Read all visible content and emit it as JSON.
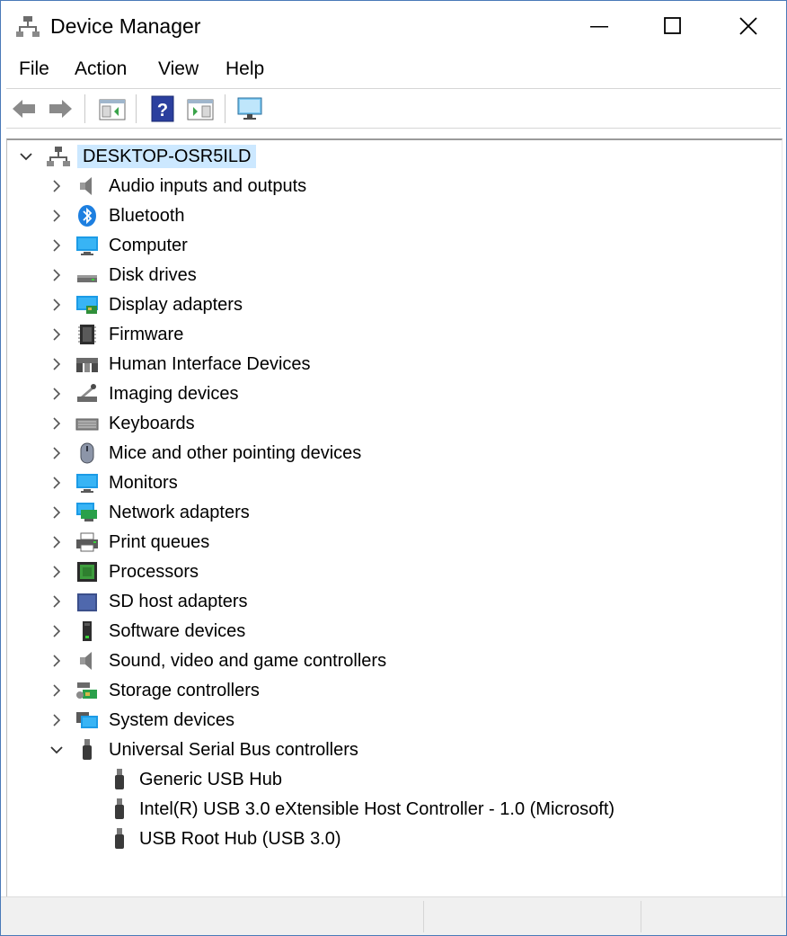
{
  "window": {
    "title": "Device Manager"
  },
  "menu": [
    {
      "label": "File"
    },
    {
      "label": "Action"
    },
    {
      "label": "View"
    },
    {
      "label": "Help"
    }
  ],
  "toolbar": {
    "buttons": [
      "back-icon",
      "forward-icon",
      "show-hide-console-tree-icon",
      "help-icon",
      "show-hide-action-pane-icon",
      "scan-hardware-changes-icon"
    ]
  },
  "tree": {
    "root": {
      "label": "DESKTOP-OSR5ILD",
      "icon": "computer-network-icon",
      "expanded": true,
      "selected": true
    },
    "categories": [
      {
        "label": "Audio inputs and outputs",
        "icon": "speaker-icon",
        "expanded": false
      },
      {
        "label": "Bluetooth",
        "icon": "bluetooth-icon",
        "expanded": false
      },
      {
        "label": "Computer",
        "icon": "monitor-icon",
        "expanded": false
      },
      {
        "label": "Disk drives",
        "icon": "disk-drive-icon",
        "expanded": false
      },
      {
        "label": "Display adapters",
        "icon": "display-adapter-icon",
        "expanded": false
      },
      {
        "label": "Firmware",
        "icon": "firmware-chip-icon",
        "expanded": false
      },
      {
        "label": "Human Interface Devices",
        "icon": "hid-icon",
        "expanded": false
      },
      {
        "label": "Imaging devices",
        "icon": "camera-icon",
        "expanded": false
      },
      {
        "label": "Keyboards",
        "icon": "keyboard-icon",
        "expanded": false
      },
      {
        "label": "Mice and other pointing devices",
        "icon": "mouse-icon",
        "expanded": false
      },
      {
        "label": "Monitors",
        "icon": "monitor-icon",
        "expanded": false
      },
      {
        "label": "Network adapters",
        "icon": "network-adapter-icon",
        "expanded": false
      },
      {
        "label": "Print queues",
        "icon": "printer-icon",
        "expanded": false
      },
      {
        "label": "Processors",
        "icon": "processor-icon",
        "expanded": false
      },
      {
        "label": "SD host adapters",
        "icon": "sd-card-icon",
        "expanded": false
      },
      {
        "label": "Software devices",
        "icon": "software-device-icon",
        "expanded": false
      },
      {
        "label": "Sound, video and game controllers",
        "icon": "speaker-icon",
        "expanded": false
      },
      {
        "label": "Storage controllers",
        "icon": "storage-controller-icon",
        "expanded": false
      },
      {
        "label": "System devices",
        "icon": "system-folder-icon",
        "expanded": false
      },
      {
        "label": "Universal Serial Bus controllers",
        "icon": "usb-plug-icon",
        "expanded": true
      }
    ],
    "usb_children": [
      {
        "label": "Generic USB Hub",
        "icon": "usb-plug-icon"
      },
      {
        "label": "Intel(R) USB 3.0 eXtensible Host Controller - 1.0 (Microsoft)",
        "icon": "usb-plug-icon"
      },
      {
        "label": "USB Root Hub (USB 3.0)",
        "icon": "usb-plug-icon"
      }
    ]
  },
  "colors": {
    "selection": "#cce8ff",
    "accent": "#1e90e0",
    "border": "#4a7ab8"
  }
}
